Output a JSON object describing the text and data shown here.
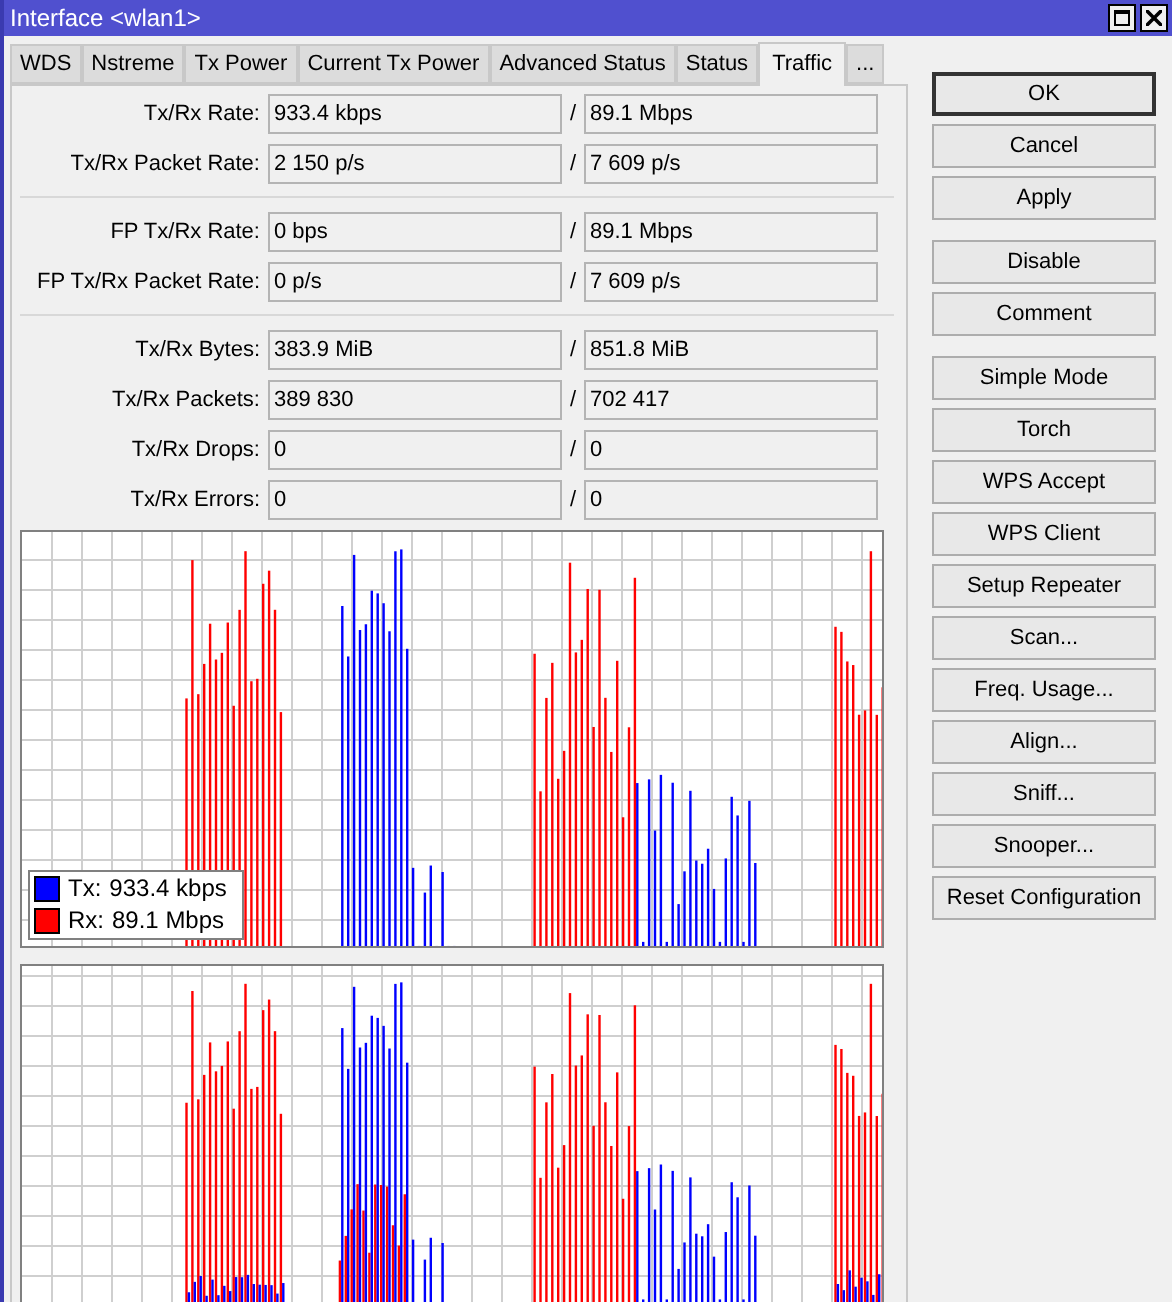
{
  "window": {
    "title": "Interface <wlan1>"
  },
  "tabs": [
    {
      "label": "WDS",
      "selected": false
    },
    {
      "label": "Nstreme",
      "selected": false
    },
    {
      "label": "Tx Power",
      "selected": false
    },
    {
      "label": "Current Tx Power",
      "selected": false
    },
    {
      "label": "Advanced Status",
      "selected": false
    },
    {
      "label": "Status",
      "selected": false
    },
    {
      "label": "Traffic",
      "selected": true
    },
    {
      "label": "...",
      "selected": false
    }
  ],
  "field_groups": [
    [
      {
        "label": "Tx/Rx Rate:",
        "tx": "933.4 kbps",
        "separator": "/",
        "rx": "89.1 Mbps"
      },
      {
        "label": "Tx/Rx Packet Rate:",
        "tx": "2 150 p/s",
        "separator": "/",
        "rx": "7 609 p/s"
      }
    ],
    [
      {
        "label": "FP Tx/Rx Rate:",
        "tx": "0 bps",
        "separator": "/",
        "rx": "89.1 Mbps"
      },
      {
        "label": "FP Tx/Rx Packet Rate:",
        "tx": "0 p/s",
        "separator": "/",
        "rx": "7 609 p/s"
      }
    ],
    [
      {
        "label": "Tx/Rx Bytes:",
        "tx": "383.9 MiB",
        "separator": "/",
        "rx": "851.8 MiB"
      },
      {
        "label": "Tx/Rx Packets:",
        "tx": "389 830",
        "separator": "/",
        "rx": "702 417"
      },
      {
        "label": "Tx/Rx Drops:",
        "tx": "0",
        "separator": "/",
        "rx": "0"
      },
      {
        "label": "Tx/Rx Errors:",
        "tx": "0",
        "separator": "/",
        "rx": "0"
      }
    ]
  ],
  "graphs": [
    {
      "kind": "traffic",
      "legend": [
        {
          "label": "Tx:",
          "value": "933.4 kbps",
          "color": "#0000ff"
        },
        {
          "label": "Rx:",
          "value": "89.1 Mbps",
          "color": "#ff0000"
        }
      ]
    },
    {
      "kind": "traffic"
    }
  ],
  "button_groups": [
    [
      "OK",
      "Cancel",
      "Apply"
    ],
    [
      "Disable",
      "Comment"
    ],
    [
      "Simple Mode",
      "Torch",
      "WPS Accept",
      "WPS Client",
      "Setup Repeater",
      "Scan...",
      "Freq. Usage...",
      "Align...",
      "Sniff...",
      "Snooper...",
      "Reset Configuration"
    ]
  ]
}
